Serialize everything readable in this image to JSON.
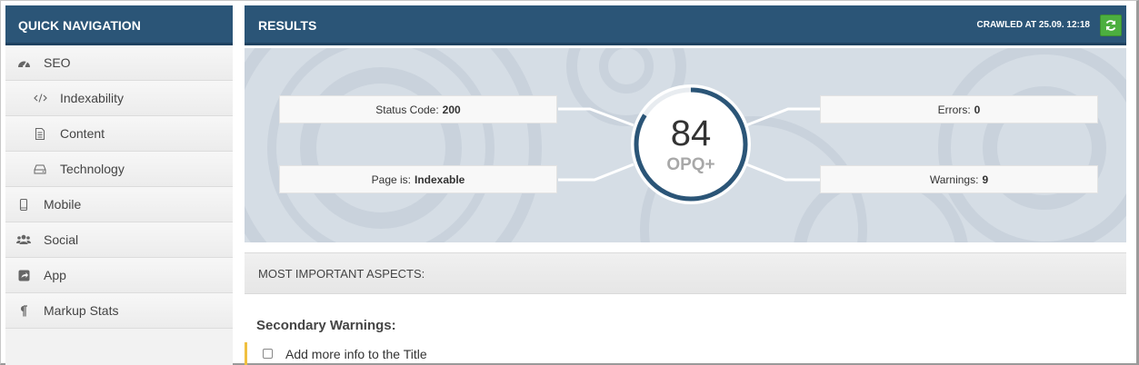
{
  "sidebar": {
    "title": "QUICK NAVIGATION",
    "items": [
      {
        "label": "SEO",
        "icon": "dashboard-icon",
        "level": "top"
      },
      {
        "label": "Indexability",
        "icon": "code-icon",
        "level": "sub"
      },
      {
        "label": "Content",
        "icon": "document-icon",
        "level": "sub"
      },
      {
        "label": "Technology",
        "icon": "hdd-icon",
        "level": "sub"
      },
      {
        "label": "Mobile",
        "icon": "mobile-icon",
        "level": "top"
      },
      {
        "label": "Social",
        "icon": "users-icon",
        "level": "top"
      },
      {
        "label": "App",
        "icon": "share-square-icon",
        "level": "top"
      },
      {
        "label": "Markup Stats",
        "icon": "paragraph-icon",
        "level": "top"
      }
    ]
  },
  "results": {
    "title": "RESULTS",
    "crawled": "CRAWLED AT 25.09. 12:18",
    "refresh_icon": "refresh-icon",
    "status_label": "Status Code:",
    "status_value": "200",
    "page_label": "Page is:",
    "page_value": "Indexable",
    "errors_label": "Errors:",
    "errors_value": "0",
    "warnings_label": "Warnings:",
    "warnings_value": "9",
    "score": "84",
    "score_fraction": 0.84,
    "score_label": "OPQ+"
  },
  "aspects": {
    "title": "MOST IMPORTANT ASPECTS:",
    "section_title": "Secondary Warnings:",
    "warnings": [
      "Add more info to the Title"
    ]
  },
  "colors": {
    "header": "#2b5577",
    "refresh": "#4caf3f",
    "warning_accent": "#f0c040"
  }
}
